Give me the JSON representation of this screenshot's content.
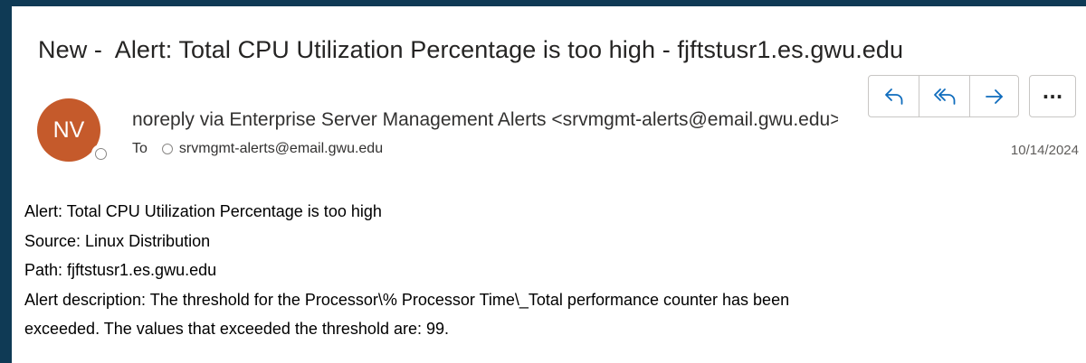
{
  "message": {
    "subject": "New -  Alert: Total CPU Utilization Percentage is too high - fjftstusr1.es.gwu.edu",
    "avatar_initials": "NV",
    "avatar_color": "#c55a2b",
    "sender": "noreply via Enterprise Server Management Alerts <srvmgmt-alerts@email.gwu.edu>",
    "to_label": "To",
    "recipient": "srvmgmt-alerts@email.gwu.edu",
    "date": "10/14/2024",
    "body_lines": [
      "Alert: Total CPU Utilization Percentage is too high",
      "Source: Linux Distribution",
      "Path: fjftstusr1.es.gwu.edu",
      "Alert description: The threshold for the Processor\\% Processor Time\\_Total performance counter has been",
      "exceeded. The values that exceeded the threshold are: 99."
    ]
  },
  "toolbar": {
    "icons": [
      "reply-icon",
      "reply-all-icon",
      "forward-icon",
      "more-icon"
    ],
    "more_label": "···",
    "accent_color": "#0f6cbd"
  },
  "frame": {
    "background_color": "#0f3a55"
  }
}
